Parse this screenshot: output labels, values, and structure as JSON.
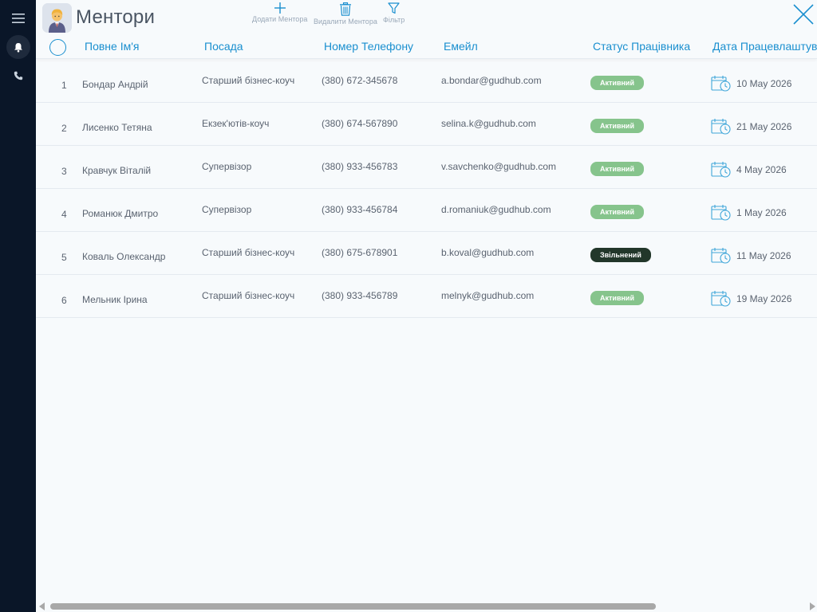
{
  "app": {
    "title": "Ментори"
  },
  "toolbar": {
    "add_label": "Додати Ментора",
    "delete_label": "Видалити Ментора",
    "filter_label": "Фільтр"
  },
  "columns": {
    "name": "Повне Ім'я",
    "position": "Посада",
    "phone": "Номер Телефону",
    "email": "Емейл",
    "status": "Статус Працівника",
    "date": "Дата Працевлаштування"
  },
  "rows": [
    {
      "num": "1",
      "name": "Бондар Андрій",
      "position": "Старший бізнес-коуч",
      "phone": "(380) 672-345678",
      "email": "a.bondar@gudhub.com",
      "status": "Активний",
      "status_type": "active",
      "date": "10 May 2026"
    },
    {
      "num": "2",
      "name": "Лисенко Тетяна",
      "position": "Екзек'ютів-коуч",
      "phone": "(380) 674-567890",
      "email": "selina.k@gudhub.com",
      "status": "Активний",
      "status_type": "active",
      "date": "21 May 2026"
    },
    {
      "num": "3",
      "name": "Кравчук Віталій",
      "position": "Супервізор",
      "phone": "(380) 933-456783",
      "email": "v.savchenko@gudhub.com",
      "status": "Активний",
      "status_type": "active",
      "date": "4 May 2026"
    },
    {
      "num": "4",
      "name": "Романюк Дмитро",
      "position": "Супервізор",
      "phone": "(380) 933-456784",
      "email": "d.romaniuk@gudhub.com",
      "status": "Активний",
      "status_type": "active",
      "date": "1 May 2026"
    },
    {
      "num": "5",
      "name": "Коваль Олександр",
      "position": "Старший бізнес-коуч",
      "phone": "(380) 675-678901",
      "email": "b.koval@gudhub.com",
      "status": "Звільнений",
      "status_type": "fired",
      "date": "11 May 2026"
    },
    {
      "num": "6",
      "name": "Мельник Ірина",
      "position": "Старший бізнес-коуч",
      "phone": "(380) 933-456789",
      "email": "melnyk@gudhub.com",
      "status": "Активний",
      "status_type": "active",
      "date": "19 May 2026"
    }
  ],
  "colors": {
    "accent": "#1a8fcf",
    "active_badge": "#86c48c",
    "fired_badge": "#22372a",
    "rail": "#0a1628"
  },
  "icons": {
    "rail": [
      "menu-icon",
      "bell-icon",
      "phone-icon"
    ],
    "toolbar": [
      "plus-icon",
      "trash-icon",
      "filter-icon"
    ],
    "close": "close-icon",
    "date": "calendar-clock-icon"
  }
}
